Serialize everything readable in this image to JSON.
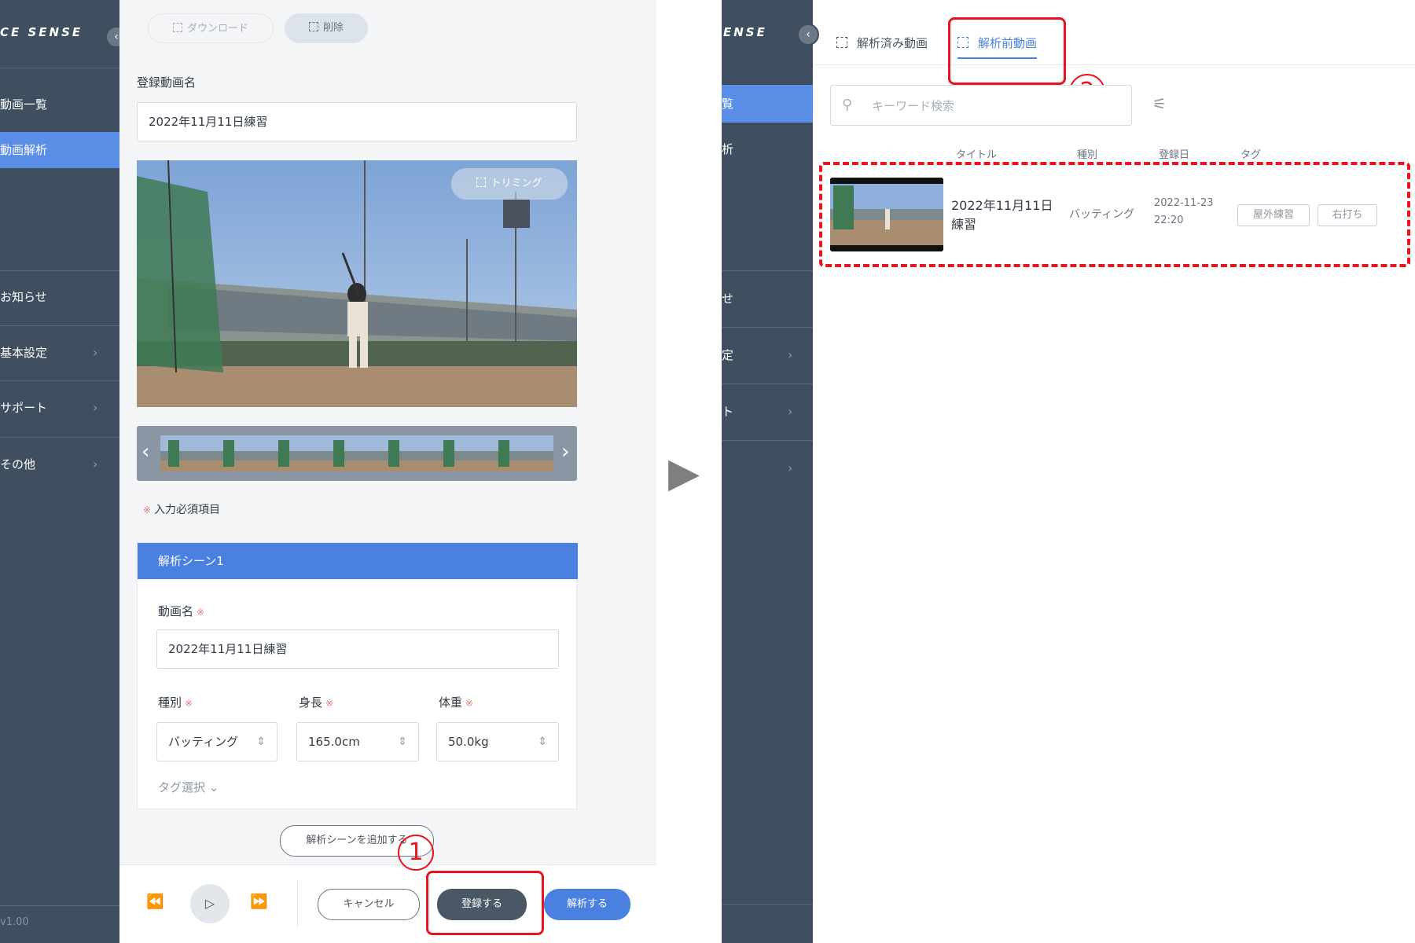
{
  "left_screen": {
    "sidebar": {
      "logo": "CE SENSE",
      "collapse_icon": "chevron-left-icon",
      "items": [
        {
          "label": "動画一覧",
          "active": false
        },
        {
          "label": "動画解析",
          "active": true
        },
        {
          "label": "お知らせ",
          "active": false
        },
        {
          "label": "基本設定",
          "active": false,
          "has_chevron": true
        },
        {
          "label": "サポート",
          "active": false,
          "has_chevron": true
        },
        {
          "label": "その他",
          "active": false,
          "has_chevron": true
        }
      ],
      "chevron": "›",
      "version": "v1.00"
    },
    "toolbar": {
      "download_label": "ダウンロード",
      "delete_label": "削除"
    },
    "video_name_label": "登録動画名",
    "video_name_value": "2022年11月11日練習",
    "trimming_label": "トリミング",
    "required_note_mark": "※",
    "required_note": "入力必須項目",
    "scene": {
      "header": "解析シーン1",
      "movie_name_label": "動画名",
      "movie_name_value": "2022年11月11日練習",
      "type_label": "種別",
      "type_value": "バッティング",
      "height_label": "身長",
      "height_value": "165.0cm",
      "weight_label": "体重",
      "weight_value": "50.0kg",
      "tag_select_label": "タグ選択",
      "required_mark": "※"
    },
    "add_scene_label": "解析シーンを追加する",
    "bottom_bar": {
      "cancel_label": "キャンセル",
      "register_label": "登録する",
      "analyze_label": "解析する"
    }
  },
  "annotations": {
    "step1": "1",
    "step2": "2",
    "arrow": "▶",
    "color": "#e8141e"
  },
  "right_screen": {
    "sidebar": {
      "logo": "ENSE",
      "collapse_icon": "chevron-left-icon",
      "items": [
        {
          "label": "覧",
          "active": true
        },
        {
          "label": "析",
          "active": false
        },
        {
          "label": "せ",
          "active": false
        },
        {
          "label": "定",
          "active": false,
          "has_chevron": true
        },
        {
          "label": "ト",
          "active": false,
          "has_chevron": true
        },
        {
          "label": "",
          "active": false,
          "has_chevron": true
        }
      ],
      "chevron": "›"
    },
    "tabs": [
      {
        "label": "解析済み動画",
        "active": false
      },
      {
        "label": "解析前動画",
        "active": true
      }
    ],
    "search_placeholder": "キーワード検索",
    "table": {
      "headers": [
        "タイトル",
        "種別",
        "登録日",
        "タグ"
      ],
      "rows": [
        {
          "title_line1": "2022年11月11日",
          "title_line2": "練習",
          "type": "バッティング",
          "date": "2022-11-23",
          "time": "22:20",
          "tags": [
            "屋外練習",
            "右打ち"
          ]
        }
      ]
    }
  },
  "colors": {
    "sidebar_bg": "#3f4f60",
    "accent_blue": "#5b8ee6",
    "register_button": "#4a5866",
    "annotation_red": "#e8141e"
  }
}
